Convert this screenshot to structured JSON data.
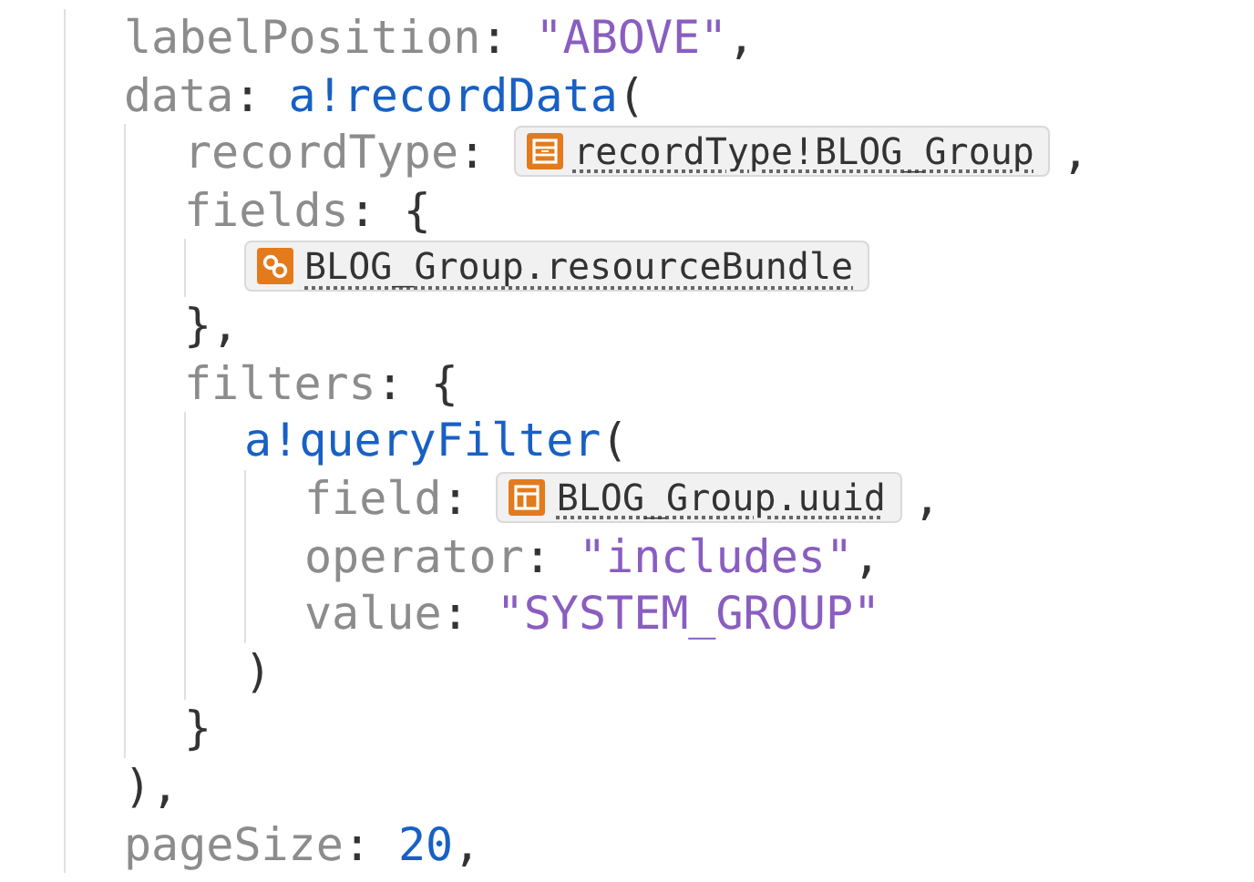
{
  "code": {
    "lines": [
      {
        "tokens": [
          {
            "kind": "key",
            "text": "labelPosition"
          },
          {
            "kind": "sep",
            "text": ":"
          },
          {
            "kind": "string",
            "text": "\"ABOVE\""
          },
          {
            "kind": "punct",
            "text": ","
          }
        ]
      },
      {
        "tokens": [
          {
            "kind": "key",
            "text": "data"
          },
          {
            "kind": "sep",
            "text": ":"
          },
          {
            "kind": "func",
            "text": "a!recordData"
          },
          {
            "kind": "punct",
            "text": "("
          }
        ],
        "children": [
          {
            "tokens": [
              {
                "kind": "key",
                "text": "recordType"
              },
              {
                "kind": "sep",
                "text": ":"
              },
              {
                "kind": "record_ref",
                "text": "recordType!BLOG_Group"
              },
              {
                "kind": "punct",
                "text": ","
              }
            ]
          },
          {
            "tokens": [
              {
                "kind": "key",
                "text": "fields"
              },
              {
                "kind": "sep",
                "text": ":"
              },
              {
                "kind": "punct",
                "text": "{"
              }
            ],
            "children": [
              {
                "tokens": [
                  {
                    "kind": "relation_ref",
                    "text": "BLOG_Group.resourceBundle"
                  }
                ]
              }
            ]
          },
          {
            "tokens": [
              {
                "kind": "punct",
                "text": "},"
              }
            ]
          },
          {
            "tokens": [
              {
                "kind": "key",
                "text": "filters"
              },
              {
                "kind": "sep",
                "text": ":"
              },
              {
                "kind": "punct",
                "text": "{"
              }
            ],
            "children": [
              {
                "tokens": [
                  {
                    "kind": "func",
                    "text": "a!queryFilter"
                  },
                  {
                    "kind": "punct",
                    "text": "("
                  }
                ],
                "children": [
                  {
                    "tokens": [
                      {
                        "kind": "key",
                        "text": "field"
                      },
                      {
                        "kind": "sep",
                        "text": ":"
                      },
                      {
                        "kind": "field_ref",
                        "text": "BLOG_Group.uuid"
                      },
                      {
                        "kind": "punct",
                        "text": ","
                      }
                    ]
                  },
                  {
                    "tokens": [
                      {
                        "kind": "key",
                        "text": "operator"
                      },
                      {
                        "kind": "sep",
                        "text": ":"
                      },
                      {
                        "kind": "string",
                        "text": "\"includes\""
                      },
                      {
                        "kind": "punct",
                        "text": ","
                      }
                    ]
                  },
                  {
                    "tokens": [
                      {
                        "kind": "key",
                        "text": "value"
                      },
                      {
                        "kind": "sep",
                        "text": ":"
                      },
                      {
                        "kind": "string",
                        "text": "\"SYSTEM_GROUP\""
                      }
                    ]
                  }
                ]
              },
              {
                "tokens": [
                  {
                    "kind": "punct",
                    "text": ")"
                  }
                ]
              }
            ]
          },
          {
            "tokens": [
              {
                "kind": "punct",
                "text": "}"
              }
            ]
          }
        ]
      },
      {
        "tokens": [
          {
            "kind": "punct",
            "text": "),"
          }
        ]
      },
      {
        "tokens": [
          {
            "kind": "key",
            "text": "pageSize"
          },
          {
            "kind": "sep",
            "text": ":"
          },
          {
            "kind": "number",
            "text": "20"
          },
          {
            "kind": "punct",
            "text": ","
          }
        ]
      }
    ]
  }
}
